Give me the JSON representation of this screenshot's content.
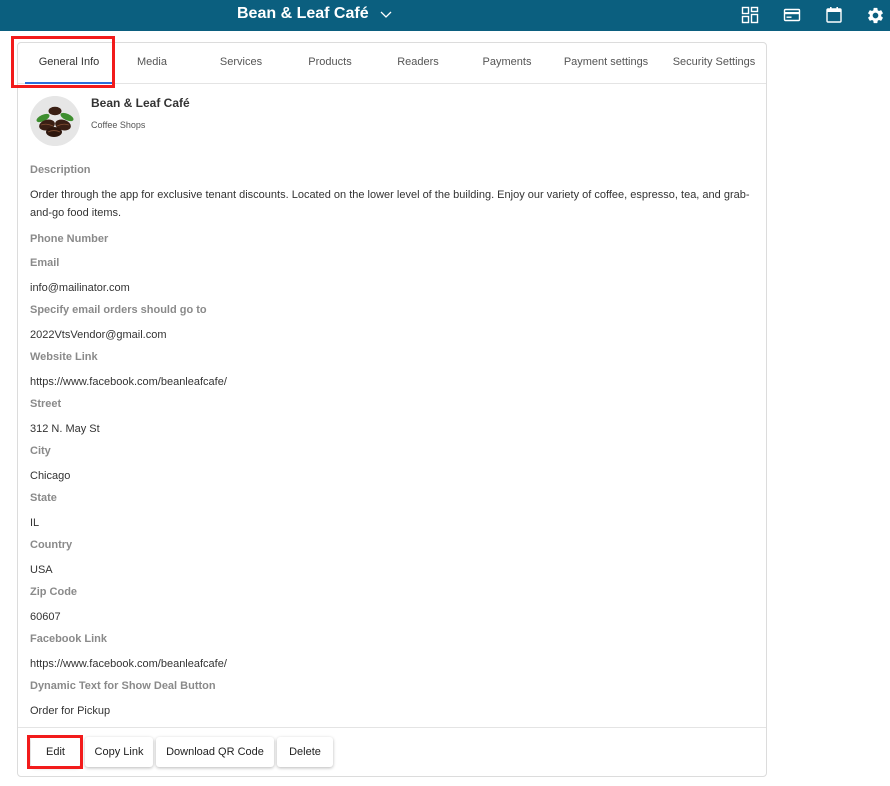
{
  "app": {
    "title": "Bean & Leaf Café",
    "accent_color": "#0b5f7f",
    "highlight_color": "#f21b1b",
    "header_icons": [
      "dashboard-icon",
      "card-icon",
      "calendar-icon",
      "gear-icon"
    ]
  },
  "tabs": [
    {
      "label": "General Info",
      "active": true
    },
    {
      "label": "Media"
    },
    {
      "label": "Services"
    },
    {
      "label": "Products"
    },
    {
      "label": "Readers"
    },
    {
      "label": "Payments"
    },
    {
      "label": "Payment settings"
    },
    {
      "label": "Security Settings"
    }
  ],
  "vendor": {
    "name": "Bean & Leaf Café",
    "category": "Coffee Shops",
    "logo_icon": "coffee-beans-icon"
  },
  "fields": [
    {
      "label": "Description",
      "value": "Order through the app for exclusive tenant discounts. Located on the lower level of the building. Enjoy our variety of coffee, espresso, tea, and grab-and-go food items."
    },
    {
      "label": "Phone Number",
      "value": ""
    },
    {
      "label": "Email",
      "value": "info@mailinator.com"
    },
    {
      "label": "Specify email orders should go to",
      "value": "2022VtsVendor@gmail.com"
    },
    {
      "label": "Website Link",
      "value": "https://www.facebook.com/beanleafcafe/"
    },
    {
      "label": "Street",
      "value": "312 N. May St"
    },
    {
      "label": "City",
      "value": "Chicago"
    },
    {
      "label": "State",
      "value": "IL"
    },
    {
      "label": "Country",
      "value": "USA"
    },
    {
      "label": "Zip Code",
      "value": "60607"
    },
    {
      "label": "Facebook Link",
      "value": "https://www.facebook.com/beanleafcafe/"
    },
    {
      "label": "Dynamic Text for Show Deal Button",
      "value": "Order for Pickup"
    }
  ],
  "actions": {
    "edit": "Edit",
    "copy_link": "Copy Link",
    "download_qr": "Download QR Code",
    "delete": "Delete"
  }
}
